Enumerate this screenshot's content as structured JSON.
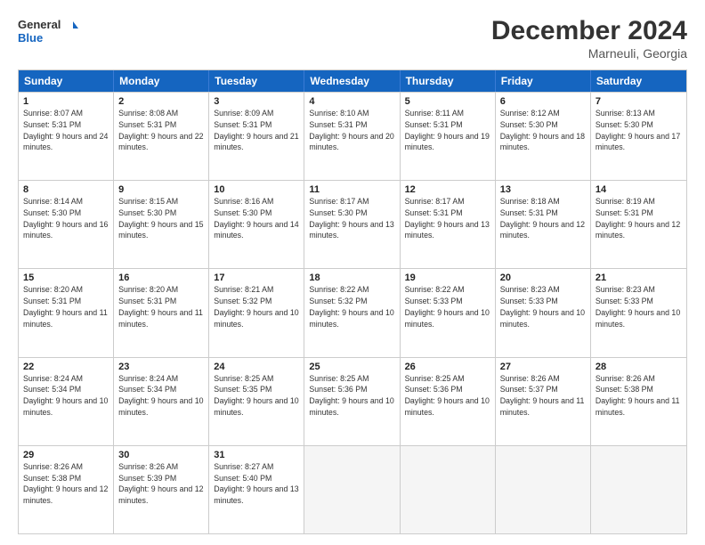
{
  "header": {
    "logo_line1": "General",
    "logo_line2": "Blue",
    "month": "December 2024",
    "location": "Marneuli, Georgia"
  },
  "days_of_week": [
    "Sunday",
    "Monday",
    "Tuesday",
    "Wednesday",
    "Thursday",
    "Friday",
    "Saturday"
  ],
  "rows": [
    [
      {
        "day": "1",
        "sunrise": "Sunrise: 8:07 AM",
        "sunset": "Sunset: 5:31 PM",
        "daylight": "Daylight: 9 hours and 24 minutes."
      },
      {
        "day": "2",
        "sunrise": "Sunrise: 8:08 AM",
        "sunset": "Sunset: 5:31 PM",
        "daylight": "Daylight: 9 hours and 22 minutes."
      },
      {
        "day": "3",
        "sunrise": "Sunrise: 8:09 AM",
        "sunset": "Sunset: 5:31 PM",
        "daylight": "Daylight: 9 hours and 21 minutes."
      },
      {
        "day": "4",
        "sunrise": "Sunrise: 8:10 AM",
        "sunset": "Sunset: 5:31 PM",
        "daylight": "Daylight: 9 hours and 20 minutes."
      },
      {
        "day": "5",
        "sunrise": "Sunrise: 8:11 AM",
        "sunset": "Sunset: 5:31 PM",
        "daylight": "Daylight: 9 hours and 19 minutes."
      },
      {
        "day": "6",
        "sunrise": "Sunrise: 8:12 AM",
        "sunset": "Sunset: 5:30 PM",
        "daylight": "Daylight: 9 hours and 18 minutes."
      },
      {
        "day": "7",
        "sunrise": "Sunrise: 8:13 AM",
        "sunset": "Sunset: 5:30 PM",
        "daylight": "Daylight: 9 hours and 17 minutes."
      }
    ],
    [
      {
        "day": "8",
        "sunrise": "Sunrise: 8:14 AM",
        "sunset": "Sunset: 5:30 PM",
        "daylight": "Daylight: 9 hours and 16 minutes."
      },
      {
        "day": "9",
        "sunrise": "Sunrise: 8:15 AM",
        "sunset": "Sunset: 5:30 PM",
        "daylight": "Daylight: 9 hours and 15 minutes."
      },
      {
        "day": "10",
        "sunrise": "Sunrise: 8:16 AM",
        "sunset": "Sunset: 5:30 PM",
        "daylight": "Daylight: 9 hours and 14 minutes."
      },
      {
        "day": "11",
        "sunrise": "Sunrise: 8:17 AM",
        "sunset": "Sunset: 5:30 PM",
        "daylight": "Daylight: 9 hours and 13 minutes."
      },
      {
        "day": "12",
        "sunrise": "Sunrise: 8:17 AM",
        "sunset": "Sunset: 5:31 PM",
        "daylight": "Daylight: 9 hours and 13 minutes."
      },
      {
        "day": "13",
        "sunrise": "Sunrise: 8:18 AM",
        "sunset": "Sunset: 5:31 PM",
        "daylight": "Daylight: 9 hours and 12 minutes."
      },
      {
        "day": "14",
        "sunrise": "Sunrise: 8:19 AM",
        "sunset": "Sunset: 5:31 PM",
        "daylight": "Daylight: 9 hours and 12 minutes."
      }
    ],
    [
      {
        "day": "15",
        "sunrise": "Sunrise: 8:20 AM",
        "sunset": "Sunset: 5:31 PM",
        "daylight": "Daylight: 9 hours and 11 minutes."
      },
      {
        "day": "16",
        "sunrise": "Sunrise: 8:20 AM",
        "sunset": "Sunset: 5:31 PM",
        "daylight": "Daylight: 9 hours and 11 minutes."
      },
      {
        "day": "17",
        "sunrise": "Sunrise: 8:21 AM",
        "sunset": "Sunset: 5:32 PM",
        "daylight": "Daylight: 9 hours and 10 minutes."
      },
      {
        "day": "18",
        "sunrise": "Sunrise: 8:22 AM",
        "sunset": "Sunset: 5:32 PM",
        "daylight": "Daylight: 9 hours and 10 minutes."
      },
      {
        "day": "19",
        "sunrise": "Sunrise: 8:22 AM",
        "sunset": "Sunset: 5:33 PM",
        "daylight": "Daylight: 9 hours and 10 minutes."
      },
      {
        "day": "20",
        "sunrise": "Sunrise: 8:23 AM",
        "sunset": "Sunset: 5:33 PM",
        "daylight": "Daylight: 9 hours and 10 minutes."
      },
      {
        "day": "21",
        "sunrise": "Sunrise: 8:23 AM",
        "sunset": "Sunset: 5:33 PM",
        "daylight": "Daylight: 9 hours and 10 minutes."
      }
    ],
    [
      {
        "day": "22",
        "sunrise": "Sunrise: 8:24 AM",
        "sunset": "Sunset: 5:34 PM",
        "daylight": "Daylight: 9 hours and 10 minutes."
      },
      {
        "day": "23",
        "sunrise": "Sunrise: 8:24 AM",
        "sunset": "Sunset: 5:34 PM",
        "daylight": "Daylight: 9 hours and 10 minutes."
      },
      {
        "day": "24",
        "sunrise": "Sunrise: 8:25 AM",
        "sunset": "Sunset: 5:35 PM",
        "daylight": "Daylight: 9 hours and 10 minutes."
      },
      {
        "day": "25",
        "sunrise": "Sunrise: 8:25 AM",
        "sunset": "Sunset: 5:36 PM",
        "daylight": "Daylight: 9 hours and 10 minutes."
      },
      {
        "day": "26",
        "sunrise": "Sunrise: 8:25 AM",
        "sunset": "Sunset: 5:36 PM",
        "daylight": "Daylight: 9 hours and 10 minutes."
      },
      {
        "day": "27",
        "sunrise": "Sunrise: 8:26 AM",
        "sunset": "Sunset: 5:37 PM",
        "daylight": "Daylight: 9 hours and 11 minutes."
      },
      {
        "day": "28",
        "sunrise": "Sunrise: 8:26 AM",
        "sunset": "Sunset: 5:38 PM",
        "daylight": "Daylight: 9 hours and 11 minutes."
      }
    ],
    [
      {
        "day": "29",
        "sunrise": "Sunrise: 8:26 AM",
        "sunset": "Sunset: 5:38 PM",
        "daylight": "Daylight: 9 hours and 12 minutes."
      },
      {
        "day": "30",
        "sunrise": "Sunrise: 8:26 AM",
        "sunset": "Sunset: 5:39 PM",
        "daylight": "Daylight: 9 hours and 12 minutes."
      },
      {
        "day": "31",
        "sunrise": "Sunrise: 8:27 AM",
        "sunset": "Sunset: 5:40 PM",
        "daylight": "Daylight: 9 hours and 13 minutes."
      },
      null,
      null,
      null,
      null
    ]
  ]
}
